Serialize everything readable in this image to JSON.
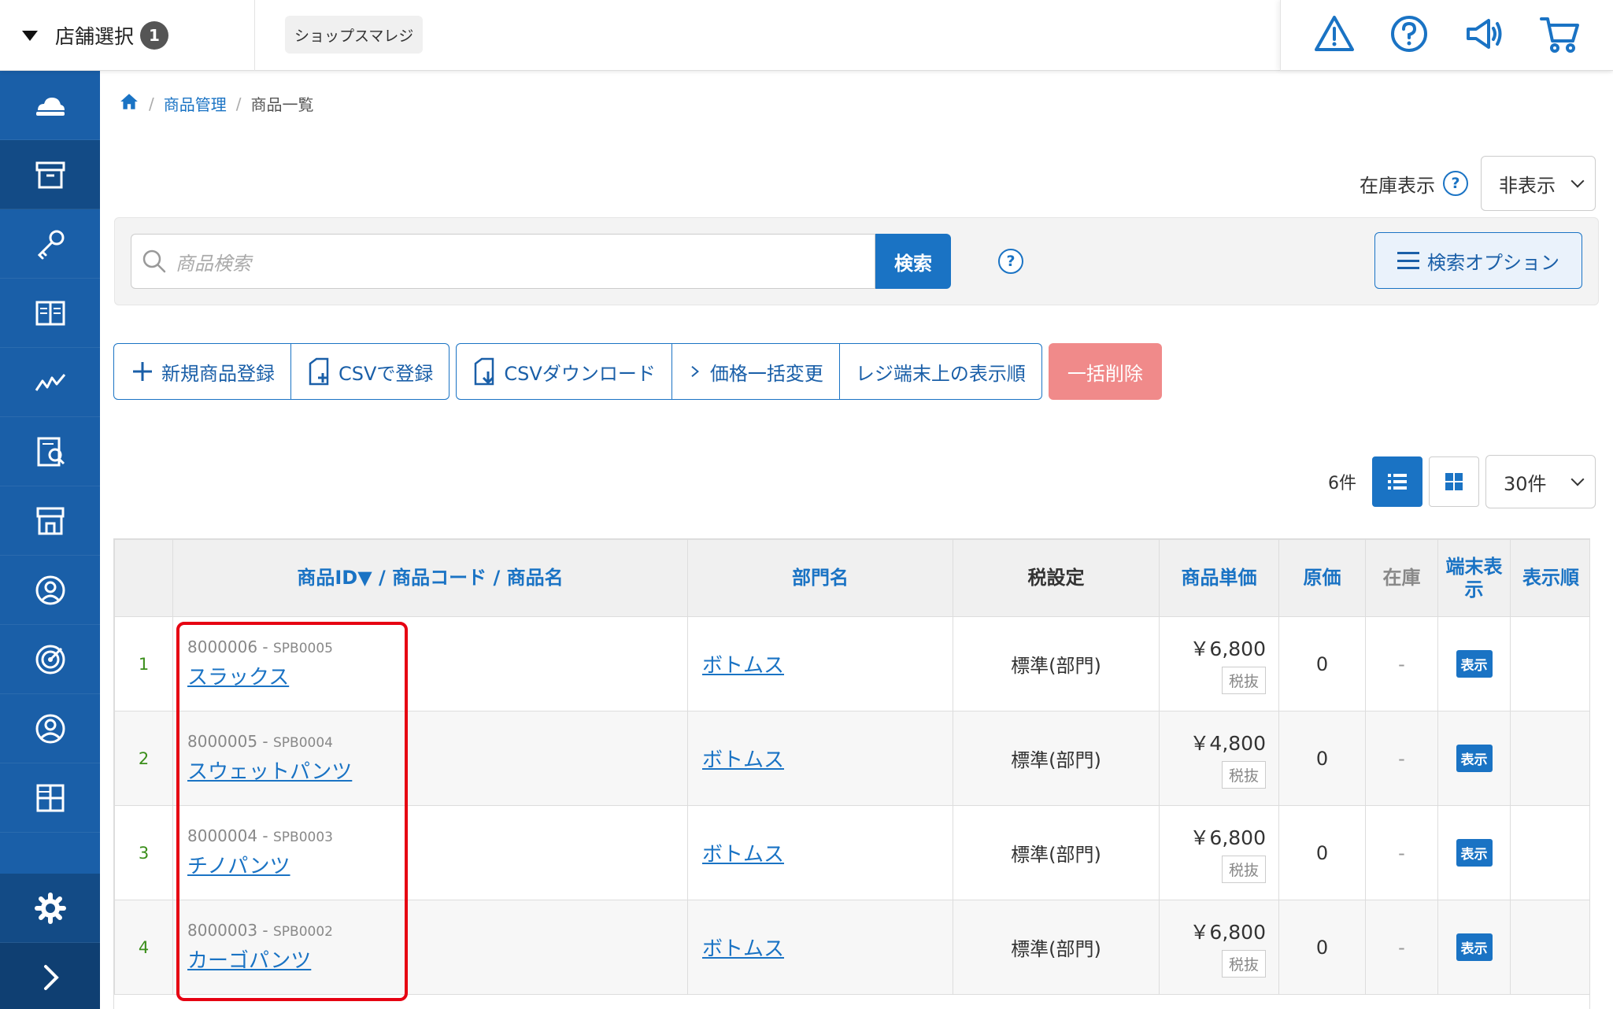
{
  "header": {
    "store_select_label": "店舗選択",
    "store_count": "1",
    "shop_name": "ショップスマレジ"
  },
  "breadcrumb": {
    "level1": "商品管理",
    "level2": "商品一覧"
  },
  "stock_display": {
    "label": "在庫表示",
    "value": "非表示"
  },
  "search": {
    "placeholder": "商品検索",
    "button": "検索",
    "options_button": "検索オプション"
  },
  "actions": {
    "new_product": "新規商品登録",
    "csv_register": "CSVで登録",
    "csv_download": "CSVダウンロード",
    "price_bulk": "価格一括変更",
    "register_order": "レジ端末上の表示順",
    "bulk_delete": "一括削除"
  },
  "list": {
    "count": "6件",
    "per_page": "30件"
  },
  "table": {
    "headers": {
      "product_id": "商品ID▼",
      "product_code": "商品コード",
      "product_name": "商品名",
      "department": "部門名",
      "tax": "税設定",
      "unit_price": "商品単価",
      "cost": "原価",
      "stock": "在庫",
      "terminal_display": "端末表示",
      "display_order": "表示順"
    },
    "rows": [
      {
        "no": "1",
        "id": "8000006",
        "code": "SPB0005",
        "name": "スラックス",
        "dept": "ボトムス",
        "tax": "標準(部門)",
        "price": "￥6,800",
        "tax_tag": "税抜",
        "cost": "0",
        "stock": "-",
        "display": "表示"
      },
      {
        "no": "2",
        "id": "8000005",
        "code": "SPB0004",
        "name": "スウェットパンツ",
        "dept": "ボトムス",
        "tax": "標準(部門)",
        "price": "￥4,800",
        "tax_tag": "税抜",
        "cost": "0",
        "stock": "-",
        "display": "表示"
      },
      {
        "no": "3",
        "id": "8000004",
        "code": "SPB0003",
        "name": "チノパンツ",
        "dept": "ボトムス",
        "tax": "標準(部門)",
        "price": "￥6,800",
        "tax_tag": "税抜",
        "cost": "0",
        "stock": "-",
        "display": "表示"
      },
      {
        "no": "4",
        "id": "8000003",
        "code": "SPB0002",
        "name": "カーゴパンツ",
        "dept": "ボトムス",
        "tax": "標準(部門)",
        "price": "￥6,800",
        "tax_tag": "税抜",
        "cost": "0",
        "stock": "-",
        "display": "表示"
      }
    ]
  },
  "colors": {
    "sidebar": "#1a5fa8",
    "accent": "#1a73c4",
    "danger": "#f08a8a",
    "highlight": "#e60012"
  },
  "icons": {
    "sidebar": [
      "cloud-logo-icon",
      "box-icon",
      "key-icon",
      "book-icon",
      "chart-icon",
      "report-icon",
      "store-icon",
      "person-icon",
      "target-icon",
      "user-icon",
      "grid-icon",
      "gear-icon",
      "expand-icon"
    ],
    "top": [
      "warning-icon",
      "help-icon",
      "megaphone-icon",
      "cart-icon"
    ]
  }
}
